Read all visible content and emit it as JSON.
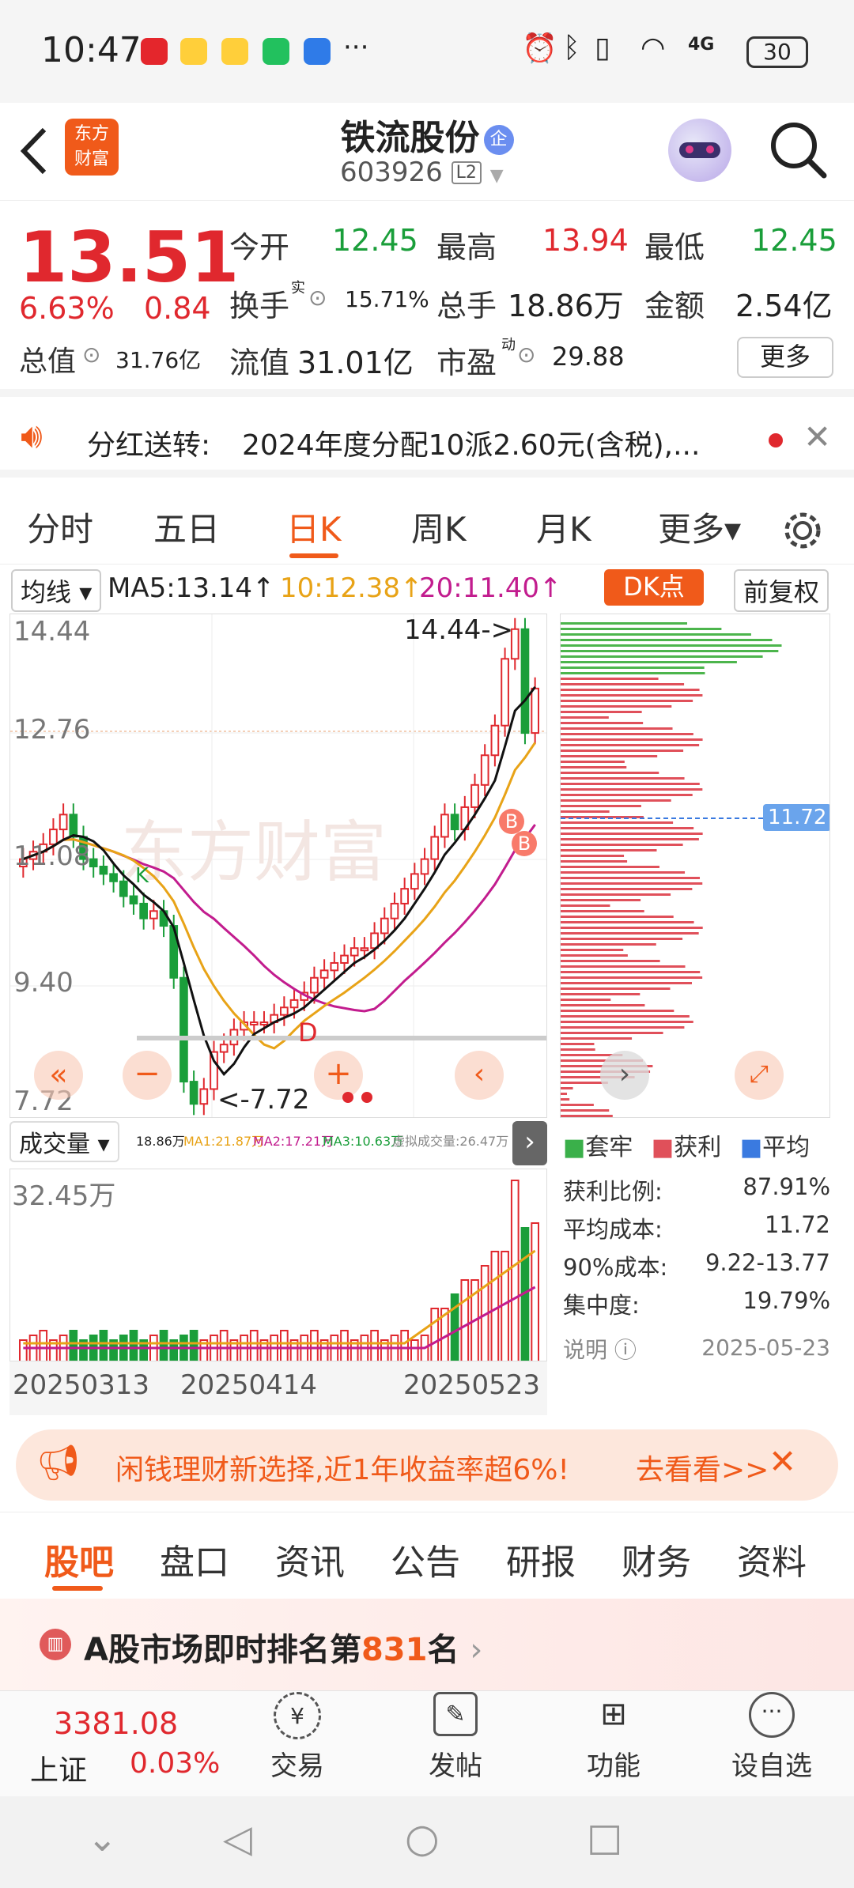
{
  "status_bar": {
    "time": "10:47",
    "battery": "30",
    "network": "4G"
  },
  "header": {
    "stock_name": "铁流股份",
    "badge": "企",
    "code": "603926",
    "level": "L2",
    "logo_line1": "东方",
    "logo_line2": "财富"
  },
  "quote": {
    "price": "13.51",
    "change_pct": "6.63%",
    "change_abs": "0.84",
    "open_label": "今开",
    "open": "12.45",
    "high_label": "最高",
    "high": "13.94",
    "low_label": "最低",
    "low": "12.45",
    "turnover_label": "换手",
    "turnover_sup": "实",
    "turnover": "15.71%",
    "volume_label": "总手",
    "volume": "18.86万",
    "amount_label": "金额",
    "amount": "2.54亿",
    "mktcap_label": "总值",
    "mktcap": "31.76亿",
    "float_label": "流值",
    "float": "31.01亿",
    "pe_label": "市盈",
    "pe_sup": "动",
    "pe": "29.88",
    "more": "更多"
  },
  "notice": {
    "label": "分红送转:",
    "text": "2024年度分配10派2.60元(含税),..."
  },
  "chart_tabs": {
    "items": [
      "分时",
      "五日",
      "日K",
      "周K",
      "月K",
      "更多▾"
    ],
    "active": 2
  },
  "ma_bar": {
    "selector": "均线",
    "ma5": "MA5:13.14↑",
    "ma10": "10:12.38↑",
    "ma20": "20:11.40↑",
    "dk": "DK点",
    "fq": "前复权"
  },
  "kline": {
    "y_labels": [
      "14.44",
      "12.76",
      "11.08",
      "9.40",
      "7.72"
    ],
    "high_marker": "14.44->",
    "low_marker": "<-7.72",
    "b_label": "B",
    "d_label": "D",
    "k_label": "K",
    "watermark": "东方财富"
  },
  "chip_dist": {
    "avg_label": "11.72",
    "legend": [
      "套牢",
      "获利",
      "平均"
    ],
    "rows": [
      {
        "label": "获利比例:",
        "value": "87.91%"
      },
      {
        "label": "平均成本:",
        "value": "11.72"
      },
      {
        "label": "90%成本:",
        "value": "9.22-13.77"
      },
      {
        "label": "集中度:",
        "value": "19.79%"
      }
    ],
    "note": "说明",
    "date": "2025-05-23"
  },
  "volume": {
    "selector": "成交量",
    "summary": "18.86万",
    "ma1": "MA1:21.87万",
    "ma2": "MA2:17.21万",
    "ma3": "MA3:10.63万",
    "virt": "虚拟成交量:26.47万",
    "max": "32.45万",
    "dates": [
      "20250313",
      "20250414",
      "20250523"
    ]
  },
  "promo": {
    "text": "闲钱理财新选择,近1年收益率超6%!",
    "link": "去看看>>"
  },
  "sub_tabs": {
    "items": [
      "股吧",
      "盘口",
      "资讯",
      "公告",
      "研报",
      "财务",
      "资料"
    ],
    "active": 0
  },
  "rank": {
    "prefix": "A股市场即时排名第",
    "num": "831",
    "suffix": "名"
  },
  "bottom": {
    "index_value": "3381.08",
    "index_name": "上证",
    "index_pct": "0.03%",
    "items": [
      "交易",
      "发帖",
      "功能",
      "设自选"
    ]
  },
  "colors": {
    "up": "#e0282e",
    "down": "#1a9e3a",
    "accent": "#f05a1a",
    "ma10": "#e8a317",
    "ma20": "#c21c8e"
  }
}
